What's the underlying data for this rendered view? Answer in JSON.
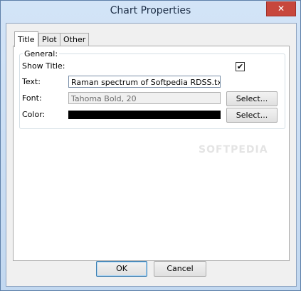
{
  "window": {
    "title": "Chart Properties",
    "close_glyph": "✕"
  },
  "tabs": [
    {
      "label": "Title",
      "active": true
    },
    {
      "label": "Plot",
      "active": false
    },
    {
      "label": "Other",
      "active": false
    }
  ],
  "general": {
    "legend": "General:",
    "show_title_label": "Show Title:",
    "show_title_checked": true,
    "check_glyph": "✔",
    "text_label": "Text:",
    "text_value": "Raman spectrum of Softpedia RDSS.txt",
    "font_label": "Font:",
    "font_value": "Tahoma Bold, 20",
    "font_select_label": "Select...",
    "color_label": "Color:",
    "color_value": "#000000",
    "color_select_label": "Select..."
  },
  "watermark": "SOFTPEDIA",
  "buttons": {
    "ok": "OK",
    "cancel": "Cancel"
  }
}
